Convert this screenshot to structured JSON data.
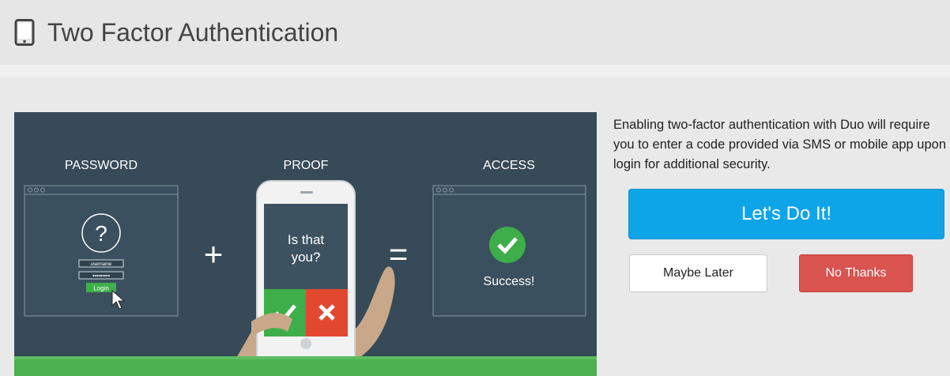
{
  "header": {
    "icon": "mobile-phone-icon",
    "title": "Two Factor Authentication"
  },
  "illustration": {
    "password_label": "PASSWORD",
    "proof_label": "PROOF",
    "access_label": "ACCESS",
    "username_text": "username",
    "password_text": "•••••••••",
    "login_text": "Login",
    "question_mark": "?",
    "plus": "+",
    "equals": "=",
    "phone_line1": "Is that",
    "phone_line2": "you?",
    "success_text": "Success!",
    "colors": {
      "background": "#364a57",
      "approve": "#3dae49",
      "deny": "#e2482f",
      "ground": "#4caf50"
    }
  },
  "description": "Enabling two-factor authentication with Duo will require you to enter a code provided via SMS or mobile app upon login for additional security.",
  "actions": {
    "primary": "Let's Do It!",
    "later": "Maybe Later",
    "decline": "No Thanks",
    "primary_color": "#0ea5e8",
    "decline_color": "#d9534f"
  }
}
